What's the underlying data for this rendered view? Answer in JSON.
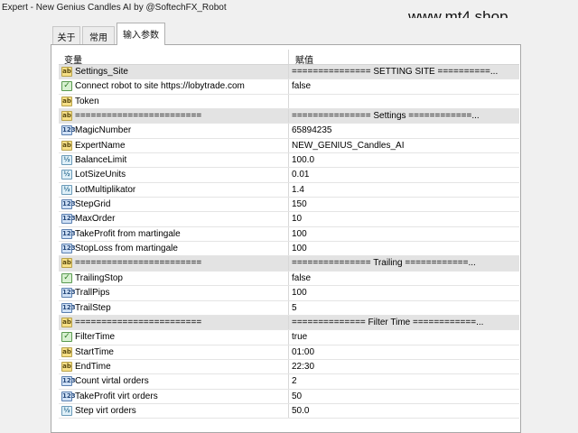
{
  "window": {
    "title": "Expert - New Genius Candles AI by @SoftechFX_Robot"
  },
  "watermark": "www.mt4.shop",
  "tabs": [
    {
      "label": "关于",
      "active": false
    },
    {
      "label": "常用",
      "active": false
    },
    {
      "label": "输入参数",
      "active": true
    }
  ],
  "table": {
    "headers": {
      "name": "变量",
      "value": "赋值"
    },
    "rows": [
      {
        "icon": "string-icon",
        "name": "Settings_Site",
        "value": "=============== SETTING SITE ==========...",
        "sep": true
      },
      {
        "icon": "bool-icon",
        "name": "Connect robot to site https://lobytrade.com",
        "value": "false",
        "sep": false
      },
      {
        "icon": "string-icon",
        "name": "Token",
        "value": "",
        "sep": false
      },
      {
        "icon": "string-icon",
        "name": "========================",
        "value": "=============== Settings ============...",
        "sep": true
      },
      {
        "icon": "int-icon",
        "name": "MagicNumber",
        "value": "65894235",
        "sep": false
      },
      {
        "icon": "string-icon",
        "name": "ExpertName",
        "value": "NEW_GENIUS_Candles_AI",
        "sep": false
      },
      {
        "icon": "double-icon",
        "name": "BalanceLimit",
        "value": "100.0",
        "sep": false
      },
      {
        "icon": "double-icon",
        "name": "LotSizeUnits",
        "value": "0.01",
        "sep": false
      },
      {
        "icon": "double-icon",
        "name": "LotMultiplikator",
        "value": "1.4",
        "sep": false
      },
      {
        "icon": "int-icon",
        "name": "StepGrid",
        "value": "150",
        "sep": false
      },
      {
        "icon": "int-icon",
        "name": "MaxOrder",
        "value": "10",
        "sep": false
      },
      {
        "icon": "int-icon",
        "name": "TakeProfit from martingale",
        "value": "100",
        "sep": false
      },
      {
        "icon": "int-icon",
        "name": "StopLoss from martingale",
        "value": "100",
        "sep": false
      },
      {
        "icon": "string-icon",
        "name": "========================",
        "value": "=============== Trailing ============...",
        "sep": true
      },
      {
        "icon": "bool-icon",
        "name": "TrailingStop",
        "value": "false",
        "sep": false
      },
      {
        "icon": "int-icon",
        "name": "TrallPips",
        "value": "100",
        "sep": false
      },
      {
        "icon": "int-icon",
        "name": "TrailStep",
        "value": "5",
        "sep": false
      },
      {
        "icon": "string-icon",
        "name": "========================",
        "value": "============== Filter Time ============...",
        "sep": true
      },
      {
        "icon": "bool-icon",
        "name": "FilterTime",
        "value": "true",
        "sep": false
      },
      {
        "icon": "string-icon",
        "name": "StartTime",
        "value": "01:00",
        "sep": false
      },
      {
        "icon": "string-icon",
        "name": "EndTime",
        "value": "22:30",
        "sep": false
      },
      {
        "icon": "int-icon",
        "name": "Count virtal orders",
        "value": "2",
        "sep": false
      },
      {
        "icon": "int-icon",
        "name": "TakeProfit virt orders",
        "value": "50",
        "sep": false
      },
      {
        "icon": "double-icon",
        "name": "Step virt orders",
        "value": "50.0",
        "sep": false
      }
    ]
  },
  "icon_glyphs": {
    "string-icon": "ab",
    "bool-icon": "✓",
    "int-icon": "123",
    "double-icon": "½"
  }
}
